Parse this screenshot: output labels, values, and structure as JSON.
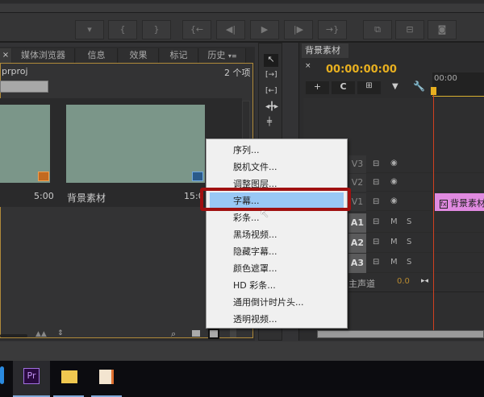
{
  "transport": {
    "buttons": [
      {
        "name": "marker",
        "icon": "▾"
      },
      {
        "name": "mark-in",
        "icon": "{"
      },
      {
        "name": "mark-out",
        "icon": "}"
      },
      {
        "name": "go-to-in",
        "icon": "{←"
      },
      {
        "name": "step-back",
        "icon": "◀|"
      },
      {
        "name": "play",
        "icon": "▶"
      },
      {
        "name": "step-forward",
        "icon": "|▶"
      },
      {
        "name": "go-to-out",
        "icon": "→}"
      },
      {
        "name": "insert",
        "icon": "⧉"
      },
      {
        "name": "overwrite",
        "icon": "⊟"
      },
      {
        "name": "export-frame",
        "icon": "◙"
      }
    ]
  },
  "project": {
    "tabs": [
      "媒体浏览器",
      "信息",
      "效果",
      "标记",
      "历史"
    ],
    "filename": "prproj",
    "item_count": "2 个项",
    "items": [
      {
        "name": "",
        "duration": "5:00"
      },
      {
        "name": "背景素材",
        "duration": "15:0"
      }
    ]
  },
  "timeline": {
    "tab": "背景素材",
    "timecode": "00:00:00:00",
    "ruler_start": "00:00",
    "video_tracks": [
      "V3",
      "V2",
      "V1"
    ],
    "audio_tracks": [
      "A1",
      "A2",
      "A3"
    ],
    "master_label": "主声道",
    "master_value": "0.0",
    "mute": "M",
    "solo": "S",
    "clip_label": "背景素材"
  },
  "menu": {
    "items": [
      "序列...",
      "脱机文件...",
      "调整图层...",
      "字幕...",
      "彩条...",
      "黑场视频...",
      "隐藏字幕...",
      "颜色遮罩...",
      "HD 彩条...",
      "通用倒计时片头...",
      "透明视频..."
    ],
    "highlighted": "字幕..."
  },
  "taskbar": {
    "apps": [
      "Pr"
    ]
  },
  "colors": {
    "timecode": "#e8b020",
    "playhead": "#d04020",
    "clip": "#e08ae0",
    "highlight": "#99c8f5",
    "callout": "#a01010"
  }
}
